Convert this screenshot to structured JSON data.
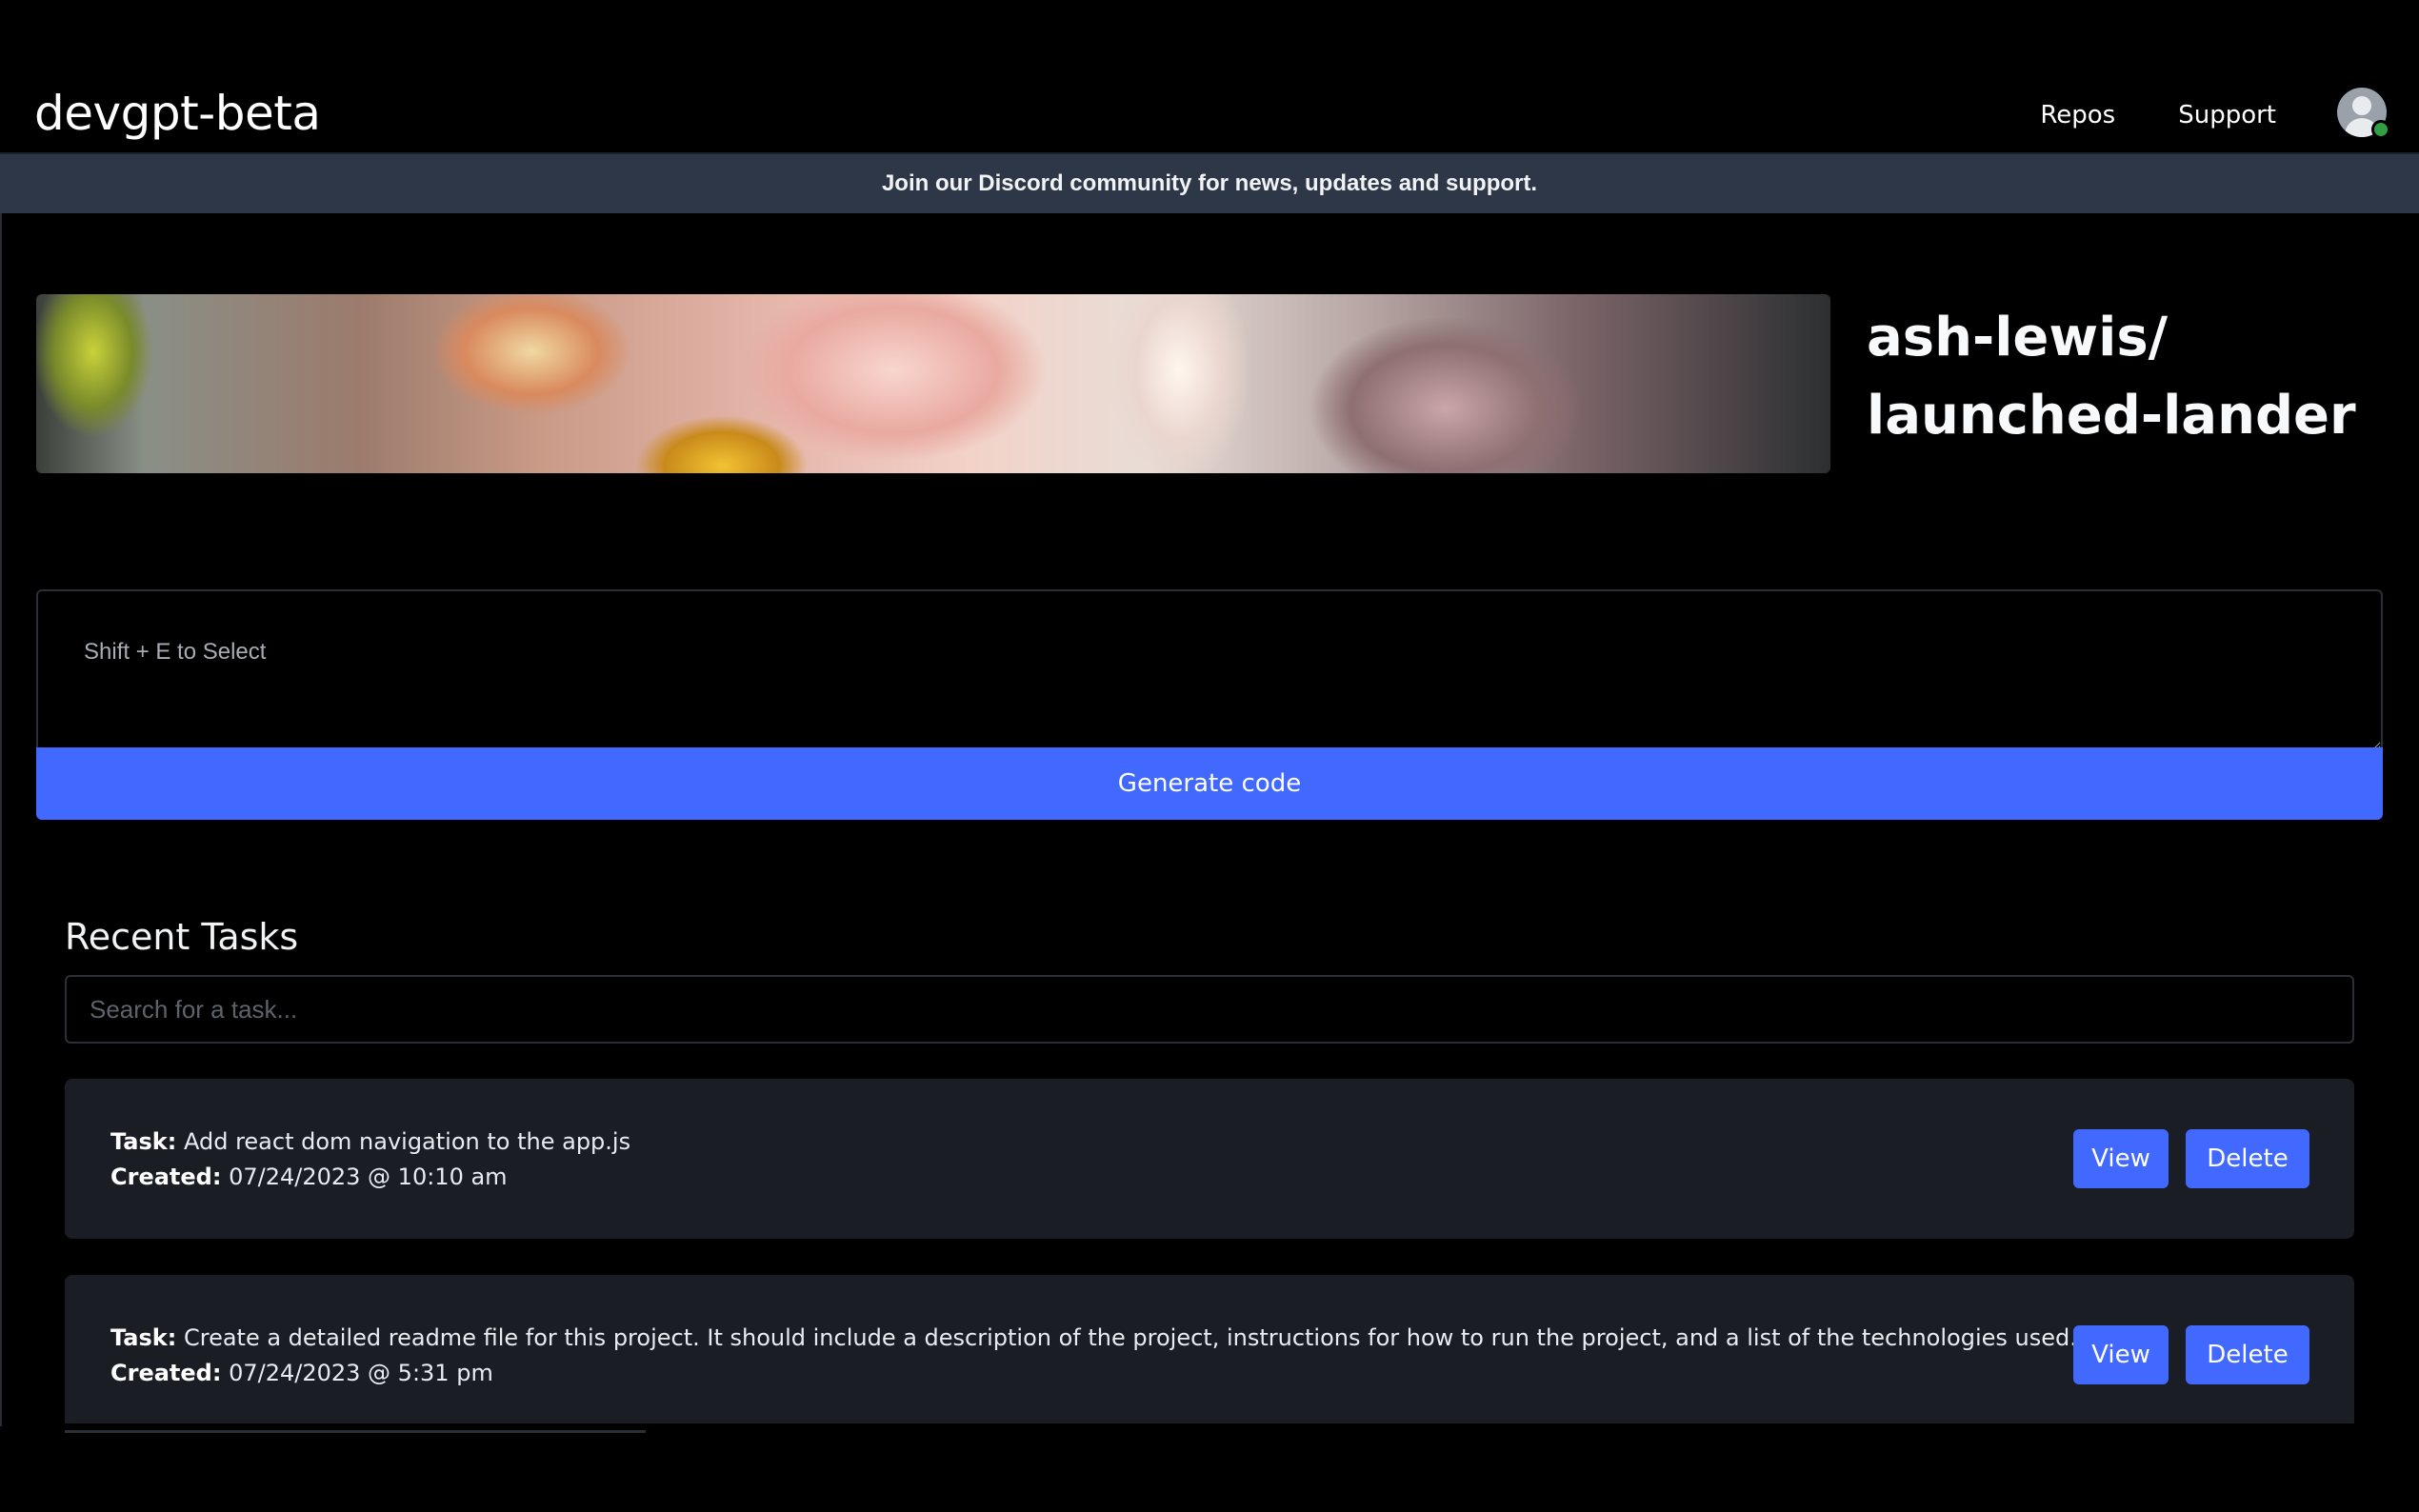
{
  "nav": {
    "brand": "devgpt-beta",
    "links": [
      "Repos",
      "Support"
    ]
  },
  "banner": {
    "text": "Join our Discord community for news, updates and support."
  },
  "repo": {
    "owner": "ash-lewis/",
    "name": "launched-lander"
  },
  "prompt": {
    "placeholder": "Shift + E to Select",
    "generate_label": "Generate code"
  },
  "tasks": {
    "title": "Recent Tasks",
    "search_placeholder": "Search for a task...",
    "task_label": "Task:",
    "created_label": "Created:",
    "view_label": "View",
    "delete_label": "Delete",
    "items": [
      {
        "task": "Add react dom navigation to the app.js",
        "created": "07/24/2023 @ 10:10 am"
      },
      {
        "task": "Create a detailed readme file for this project. It should include a description of the project, instructions for how to run the project, and a list of the technologies used.",
        "created": "07/24/2023 @ 5:31 pm"
      }
    ]
  },
  "colors": {
    "primary": "#4169ff",
    "banner_bg": "#2d3748",
    "card_bg": "#1a1d24",
    "online": "#2f9e44"
  }
}
